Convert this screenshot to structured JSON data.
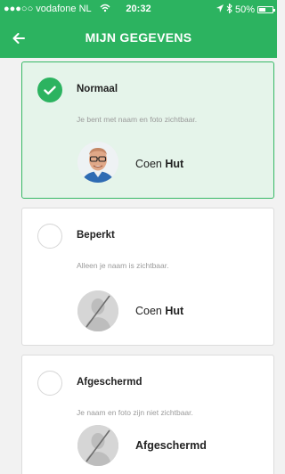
{
  "status_bar": {
    "carrier": "●●●○○ vodafone NL",
    "time": "20:32",
    "battery": "50%",
    "battery_level": 0.5
  },
  "header": {
    "title": "MIJN GEGEVENS",
    "back_icon": "arrow-left-icon"
  },
  "options": [
    {
      "title": "Normaal",
      "description": "Je bent met naam en foto zichtbaar.",
      "first_name": "Coen",
      "last_name": "Hut",
      "selected": true,
      "avatar": "photo"
    },
    {
      "title": "Beperkt",
      "description": "Alleen je naam is zichtbaar.",
      "first_name": "Coen",
      "last_name": "Hut",
      "selected": false,
      "avatar": "placeholder-crossed"
    },
    {
      "title": "Afgeschermd",
      "description": "Je naam en foto zijn niet zichtbaar.",
      "display_name": "Afgeschermd",
      "selected": false,
      "avatar": "placeholder-crossed"
    }
  ],
  "colors": {
    "accent": "#2cb360",
    "selected_bg": "#e5f4ea",
    "page_bg": "#f2f2f2"
  }
}
